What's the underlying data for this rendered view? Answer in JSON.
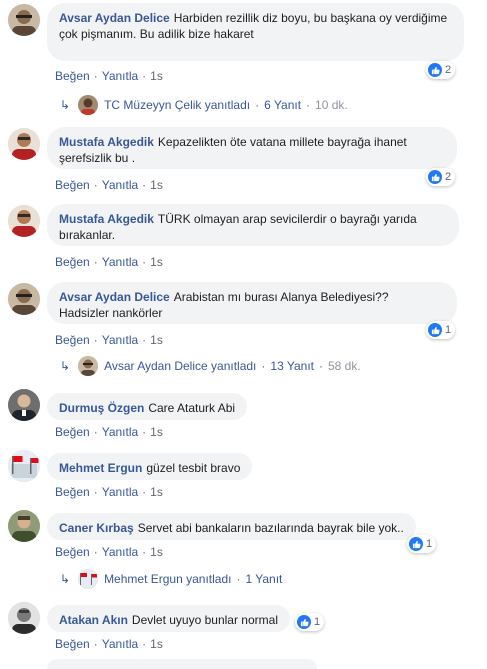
{
  "colors": {
    "link": "#385898",
    "bubble": "#f2f3f5",
    "like": "#2078f4",
    "meta": "#606770"
  },
  "actions": {
    "like": "Beğen",
    "reply": "Yanıtla"
  },
  "comments": [
    {
      "author": "Avsar Aydan Delice",
      "text": "Harbiden rezillik diz boyu, bu başkana oy verdiğime",
      "text2": "çok pişmanım. Bu adilik bize hakaret",
      "time": "1s",
      "reactions": "2"
    },
    {
      "author": "Mustafa Akgedik",
      "text": "Kepazelikten öte vatana millete bayrağa ihanet",
      "text2": "şerefsizlik bu .",
      "time": "1s",
      "reactions": "2"
    },
    {
      "author": "Mustafa Akgedik",
      "text": "TÜRK olmayan arap sevicilerdir o bayrağı yarıda",
      "text2": "bırakanlar.",
      "time": "1s"
    },
    {
      "author": "Avsar Aydan Delice",
      "text": "Arabistan mı burası Alanya Belediyesi??",
      "text2": "Hadsizler nankörler",
      "time": "1s",
      "reactions": "1"
    },
    {
      "author": "Durmuş Özgen",
      "text": "Care Ataturk Abi",
      "time": "1s"
    },
    {
      "author": "Mehmet Ergun",
      "text": "güzel tesbit bravo",
      "time": "1s"
    },
    {
      "author": "Caner Kırbaş",
      "text": "Servet abi bankaların bazılarında bayrak bile yok..",
      "time": "1s",
      "reactions": "1"
    },
    {
      "author": "Atakan Akın",
      "text": "Devlet uyuyo bunlar normal",
      "time": "1s",
      "reactions": "1"
    }
  ],
  "reply_threads": [
    {
      "name": "TC Müzeyyn Çelik yanıtladı",
      "count": "6 Yanıt",
      "time": "10 dk."
    },
    {
      "name": "Avsar Aydan Delice yanıtladı",
      "count": "13 Yanıt",
      "time": "58 dk."
    },
    {
      "name": "Mehmet Ergun yanıtladı",
      "count": "1 Yanıt",
      "time": ""
    }
  ],
  "dot": "·",
  "reply_arrow": "↳"
}
